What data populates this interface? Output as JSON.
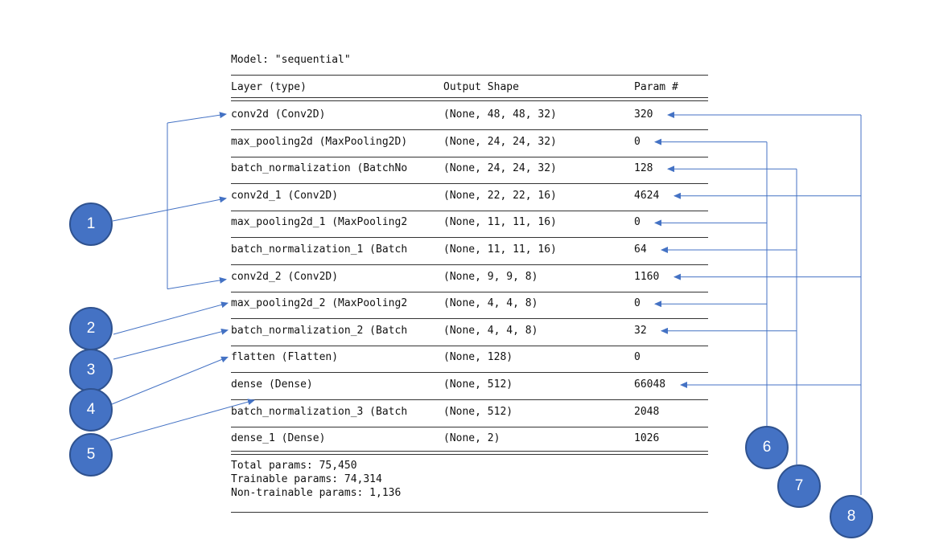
{
  "summary": {
    "model_title": "Model: \"sequential\"",
    "headers": {
      "layer": "Layer (type)",
      "output_shape": "Output Shape",
      "params": "Param #"
    },
    "layers": [
      {
        "name": "conv2d (Conv2D)",
        "shape": "(None, 48, 48, 32)",
        "params": "320"
      },
      {
        "name": "max_pooling2d (MaxPooling2D)",
        "shape": "(None, 24, 24, 32)",
        "params": "0"
      },
      {
        "name": "batch_normalization (BatchNo",
        "shape": "(None, 24, 24, 32)",
        "params": "128"
      },
      {
        "name": "conv2d_1 (Conv2D)",
        "shape": "(None, 22, 22, 16)",
        "params": "4624"
      },
      {
        "name": "max_pooling2d_1 (MaxPooling2",
        "shape": "(None, 11, 11, 16)",
        "params": "0"
      },
      {
        "name": "batch_normalization_1 (Batch",
        "shape": "(None, 11, 11, 16)",
        "params": "64"
      },
      {
        "name": "conv2d_2 (Conv2D)",
        "shape": "(None, 9, 9, 8)",
        "params": "1160"
      },
      {
        "name": "max_pooling2d_2 (MaxPooling2",
        "shape": "(None, 4, 4, 8)",
        "params": "0"
      },
      {
        "name": "batch_normalization_2 (Batch",
        "shape": "(None, 4, 4, 8)",
        "params": "32"
      },
      {
        "name": "flatten (Flatten)",
        "shape": "(None, 128)",
        "params": "0"
      },
      {
        "name": "dense (Dense)",
        "shape": "(None, 512)",
        "params": "66048"
      },
      {
        "name": "batch_normalization_3 (Batch",
        "shape": "(None, 512)",
        "params": "2048"
      },
      {
        "name": "dense_1 (Dense)",
        "shape": "(None, 2)",
        "params": "1026"
      }
    ],
    "totals": {
      "total": "Total params: 75,450",
      "trainable": "Trainable params: 74,314",
      "non_trainable": "Non-trainable params: 1,136"
    }
  },
  "callouts": [
    {
      "label": "1",
      "targets": [
        0,
        3,
        6
      ],
      "side": "left"
    },
    {
      "label": "2",
      "targets": [
        7
      ],
      "side": "left"
    },
    {
      "label": "3",
      "targets": [
        8
      ],
      "side": "left"
    },
    {
      "label": "4",
      "targets": [
        9
      ],
      "side": "left"
    },
    {
      "label": "5",
      "targets": [
        10
      ],
      "side": "left"
    },
    {
      "label": "6",
      "targets": [
        1,
        4,
        7
      ],
      "side": "right"
    },
    {
      "label": "7",
      "targets": [
        2,
        5,
        8
      ],
      "side": "right"
    },
    {
      "label": "8",
      "targets": [
        0,
        3,
        6,
        10
      ],
      "side": "right"
    }
  ],
  "colors": {
    "callout_fill": "#4472c4",
    "callout_border": "#2f528f",
    "arrow": "#4472c4",
    "text": "#111111"
  }
}
